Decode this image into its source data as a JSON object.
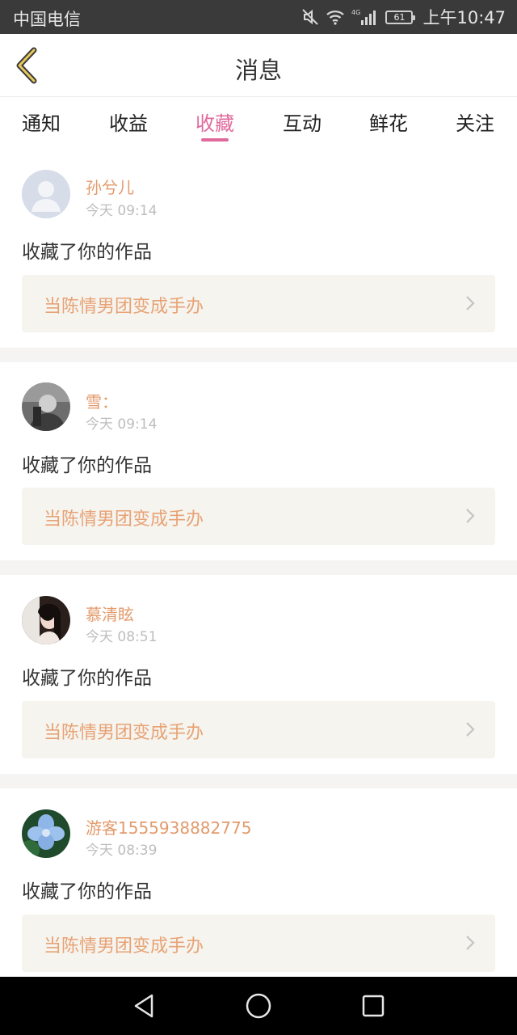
{
  "status_bar": {
    "carrier": "中国电信",
    "network": "4G",
    "battery": "61",
    "time": "上午10:47"
  },
  "header": {
    "back_icon": "chevron-left-icon",
    "title": "消息"
  },
  "tabs": [
    {
      "label": "通知",
      "active": false
    },
    {
      "label": "收益",
      "active": false
    },
    {
      "label": "收藏",
      "active": true
    },
    {
      "label": "互动",
      "active": false
    },
    {
      "label": "鲜花",
      "active": false
    },
    {
      "label": "关注",
      "active": false
    }
  ],
  "messages": [
    {
      "user": "孙兮儿",
      "time": "今天 09:14",
      "action": "收藏了你的作品",
      "work": "当陈情男团变成手办"
    },
    {
      "user": "雪：",
      "time": "今天 09:14",
      "action": "收藏了你的作品",
      "work": "当陈情男团变成手办"
    },
    {
      "user": "慕清眩",
      "time": "今天 08:51",
      "action": "收藏了你的作品",
      "work": "当陈情男团变成手办"
    },
    {
      "user": "游客1555938882775",
      "time": "今天 08:39",
      "action": "收藏了你的作品",
      "work": "当陈情男团变成手办"
    }
  ],
  "colors": {
    "accent": "#e0699b",
    "username": "#e39a6b",
    "work_title": "#e8a274",
    "card_bg": "#f5f4ef"
  }
}
